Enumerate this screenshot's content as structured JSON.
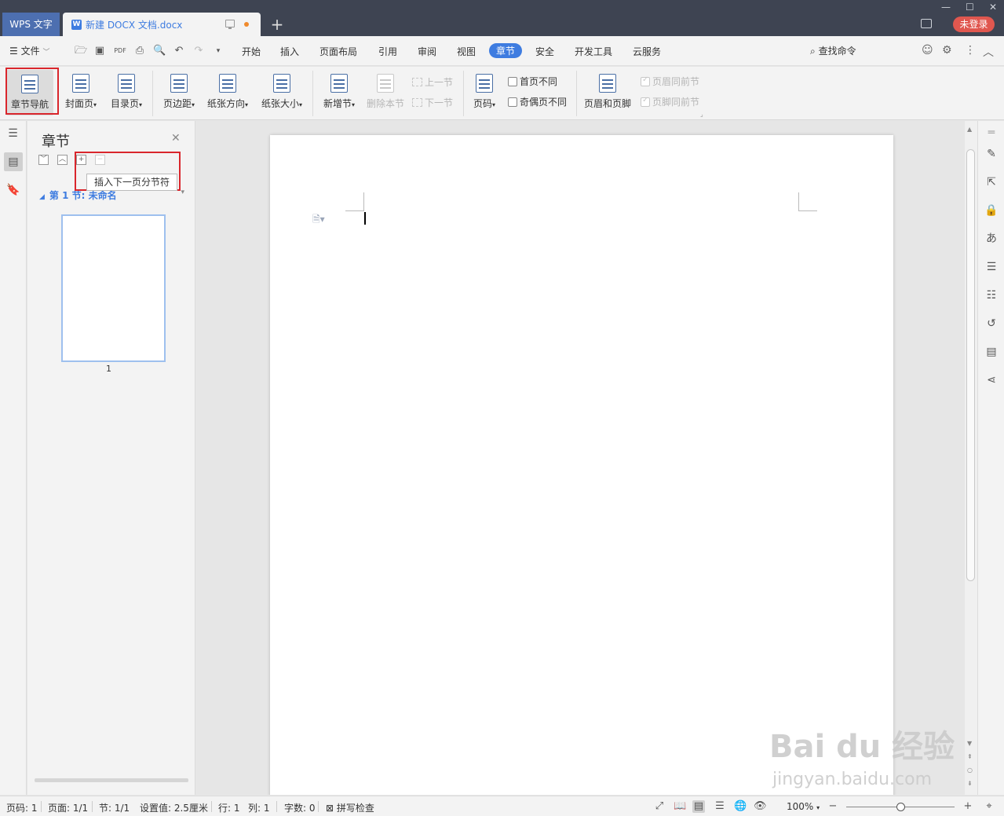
{
  "titlebar": {
    "app_tab": "WPS 文字",
    "doc_tab": "新建 DOCX 文档.docx",
    "new_tab": "+",
    "login": "未登录"
  },
  "menubar": {
    "file": "文件",
    "items": [
      "开始",
      "插入",
      "页面布局",
      "引用",
      "审阅",
      "视图",
      "章节",
      "安全",
      "开发工具",
      "云服务"
    ],
    "active": "章节",
    "find": "查找命令"
  },
  "ribbon": {
    "section_nav": "章节导航",
    "cover": "封面页",
    "toc_page": "目录页",
    "margins": "页边距",
    "orientation": "纸张方向",
    "size": "纸张大小",
    "new_section": "新增节",
    "delete_section": "删除本节",
    "prev_section": "上一节",
    "next_section": "下一节",
    "page_number": "页码",
    "first_page_diff": "首页不同",
    "odd_even_diff": "奇偶页不同",
    "header_footer": "页眉和页脚",
    "header_same_prev": "页眉同前节",
    "footer_same_prev": "页脚同前节"
  },
  "panel": {
    "title": "章节",
    "tooltip": "插入下一页分节符",
    "section_label": "第 1 节: 未命名",
    "page_number": "1"
  },
  "statusbar": {
    "page_num": "页码: 1",
    "pages": "页面: 1/1",
    "section": "节: 1/1",
    "setting": "设置值: 2.5厘米",
    "row": "行: 1",
    "col": "列: 1",
    "words": "字数: 0",
    "spell": "拼写检查",
    "zoom": "100%"
  },
  "watermark": {
    "main": "Bai du 经验",
    "sub": "jingyan.baidu.com"
  }
}
